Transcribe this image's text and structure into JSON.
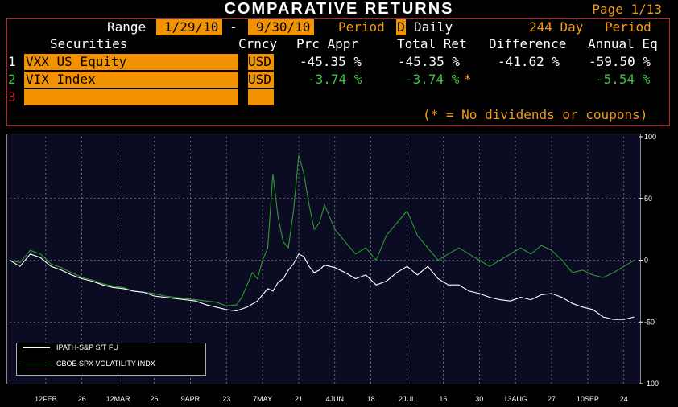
{
  "header": {
    "title": "COMPARATIVE RETURNS",
    "page_label": "Page",
    "page_value": "1/13"
  },
  "range": {
    "label": "Range",
    "start": "1/29/10",
    "dash": "-",
    "end": "9/30/10",
    "period_label": "Period",
    "period_code": "D",
    "period_name": "Daily",
    "day_count": "244 Day",
    "period_word": "Period"
  },
  "table": {
    "headers": [
      "Securities",
      "Crncy",
      "Prc Appr",
      "Total Ret",
      "Difference",
      "Annual Eq"
    ],
    "rows": [
      {
        "num": "1",
        "security": "VXX US Equity",
        "crncy": "USD",
        "prc_appr": "-45.35 %",
        "total_ret": "-45.35 %",
        "difference": "-41.62 %",
        "annual_eq": "-59.50 %"
      },
      {
        "num": "2",
        "security": "VIX Index",
        "crncy": "USD",
        "prc_appr": "-3.74 %",
        "total_ret": "-3.74 %",
        "star": "*",
        "difference": "",
        "annual_eq": "-5.54 %"
      },
      {
        "num": "3",
        "security": "",
        "crncy": "",
        "prc_appr": "",
        "total_ret": "",
        "difference": "",
        "annual_eq": ""
      }
    ],
    "footnote": "(* = No dividends or coupons)"
  },
  "colors": {
    "background": "#000000",
    "accent_orange": "#f39200",
    "series_white": "#ffffff",
    "series_green": "#2e9a2e",
    "plot_bg": "#0b0c24"
  },
  "chart_data": {
    "type": "line",
    "y_range": [
      -100,
      100
    ],
    "y_ticks": [
      100,
      50,
      0,
      -50,
      -100
    ],
    "y_tick_labels": [
      "100",
      "50",
      "0",
      "-50",
      "-100"
    ],
    "x_tick_labels": [
      "12FEB",
      "26",
      "12MAR",
      "26",
      "9APR",
      "23",
      "7MAY",
      "21",
      "4JUN",
      "18",
      "2JUL",
      "16",
      "30",
      "13AUG",
      "27",
      "10SEP",
      "24"
    ],
    "x_tick_days": [
      14,
      28,
      42,
      56,
      70,
      84,
      98,
      112,
      126,
      140,
      154,
      168,
      182,
      196,
      210,
      224,
      238
    ],
    "x_range_days": [
      0,
      244
    ],
    "grid": true,
    "legend_position": "bottom-left",
    "series": [
      {
        "name": "IPATH-S&P S/T FU",
        "color": "#ffffff",
        "x": [
          0,
          4,
          8,
          12,
          16,
          20,
          24,
          28,
          32,
          36,
          40,
          44,
          48,
          52,
          56,
          60,
          64,
          68,
          72,
          76,
          80,
          84,
          88,
          92,
          96,
          98,
          100,
          102,
          104,
          106,
          108,
          110,
          112,
          114,
          116,
          118,
          120,
          122,
          126,
          130,
          134,
          138,
          142,
          146,
          150,
          154,
          158,
          162,
          166,
          170,
          174,
          178,
          182,
          186,
          190,
          194,
          198,
          202,
          206,
          210,
          214,
          218,
          222,
          226,
          230,
          234,
          238,
          242
        ],
        "y": [
          0,
          -5,
          5,
          2,
          -5,
          -8,
          -12,
          -15,
          -17,
          -20,
          -22,
          -23,
          -25,
          -26,
          -29,
          -30,
          -31,
          -32,
          -33,
          -36,
          -38,
          -40,
          -41,
          -38,
          -33,
          -28,
          -23,
          -25,
          -18,
          -15,
          -8,
          -3,
          5,
          3,
          -5,
          -10,
          -8,
          -4,
          -6,
          -10,
          -15,
          -12,
          -20,
          -17,
          -10,
          -5,
          -12,
          -5,
          -15,
          -20,
          -20,
          -25,
          -27,
          -30,
          -32,
          -33,
          -30,
          -32,
          -28,
          -27,
          -30,
          -35,
          -38,
          -40,
          -46,
          -48,
          -48,
          -46
        ]
      },
      {
        "name": "CBOE SPX VOLATILITY INDX",
        "color": "#2e9a2e",
        "x": [
          0,
          4,
          8,
          12,
          16,
          20,
          24,
          28,
          32,
          36,
          40,
          44,
          48,
          52,
          56,
          60,
          64,
          68,
          72,
          76,
          80,
          84,
          88,
          90,
          92,
          94,
          96,
          98,
          100,
          102,
          104,
          106,
          108,
          110,
          112,
          114,
          116,
          118,
          120,
          122,
          126,
          130,
          134,
          138,
          142,
          146,
          150,
          154,
          158,
          162,
          166,
          170,
          174,
          178,
          182,
          186,
          190,
          194,
          198,
          202,
          206,
          210,
          214,
          218,
          222,
          226,
          230,
          234,
          238,
          242
        ],
        "y": [
          0,
          -2,
          8,
          5,
          -3,
          -6,
          -10,
          -14,
          -16,
          -19,
          -21,
          -22,
          -25,
          -26,
          -27,
          -29,
          -30,
          -31,
          -32,
          -33,
          -34,
          -37,
          -36,
          -30,
          -20,
          -10,
          -15,
          0,
          10,
          70,
          35,
          15,
          10,
          40,
          85,
          70,
          45,
          25,
          30,
          45,
          25,
          15,
          5,
          10,
          0,
          20,
          30,
          40,
          20,
          10,
          0,
          5,
          10,
          5,
          0,
          -5,
          0,
          5,
          10,
          5,
          12,
          8,
          0,
          -10,
          -8,
          -12,
          -14,
          -10,
          -5,
          0
        ]
      }
    ]
  }
}
